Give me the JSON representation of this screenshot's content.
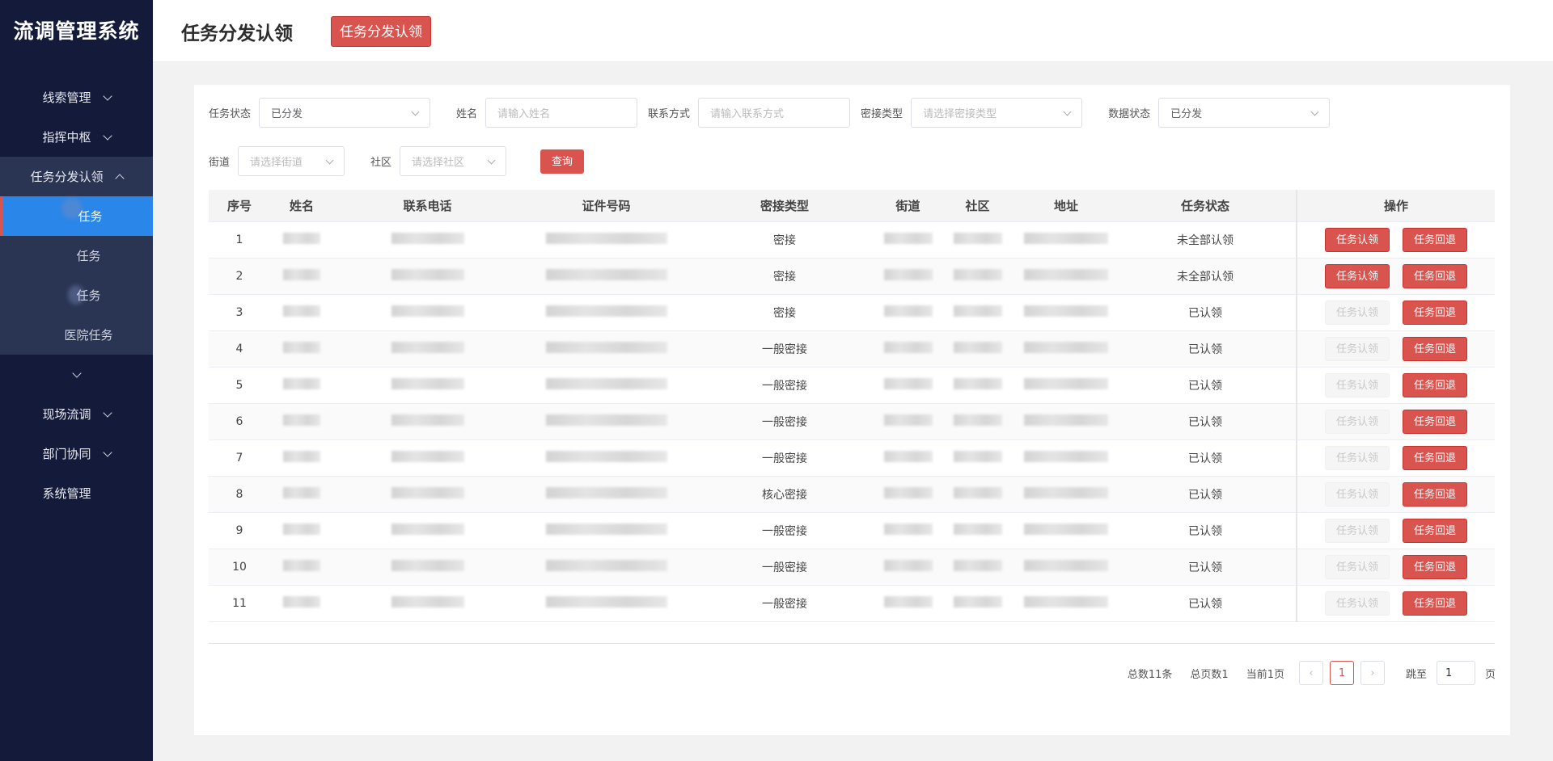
{
  "app": {
    "title": "流调管理系统"
  },
  "sidebar": {
    "items": [
      {
        "label": "线索管理",
        "expand": "down"
      },
      {
        "label": "指挥中枢",
        "expand": "down"
      },
      {
        "label": "任务分发认领",
        "expand": "up"
      },
      {
        "label": "",
        "expand": "down"
      },
      {
        "label": "现场流调",
        "expand": "down"
      },
      {
        "label": "部门协同",
        "expand": "down"
      },
      {
        "label": "系统管理",
        "expand": ""
      }
    ],
    "submenu": [
      {
        "label": "任务",
        "active": true
      },
      {
        "label": "任务",
        "active": false
      },
      {
        "label": "任务",
        "active": false
      },
      {
        "label": "医院任务",
        "active": false
      }
    ]
  },
  "header": {
    "title": "任务分发认领",
    "tag": "任务分发认领"
  },
  "filters": {
    "task_status": {
      "label": "任务状态",
      "value": "已分发"
    },
    "name": {
      "label": "姓名",
      "placeholder": "请输入姓名"
    },
    "contact": {
      "label": "联系方式",
      "placeholder": "请输入联系方式"
    },
    "contact_type": {
      "label": "密接类型",
      "placeholder": "请选择密接类型"
    },
    "data_status": {
      "label": "数据状态",
      "value": "已分发"
    },
    "street": {
      "label": "街道",
      "placeholder": "请选择街道"
    },
    "community": {
      "label": "社区",
      "placeholder": "请选择社区"
    },
    "query_label": "查询"
  },
  "table": {
    "columns": [
      "序号",
      "姓名",
      "联系电话",
      "证件号码",
      "密接类型",
      "街道",
      "社区",
      "地址",
      "任务状态",
      "操作"
    ],
    "claim_label": "任务认领",
    "return_label": "任务回退",
    "rows": [
      {
        "no": "1",
        "type": "密接",
        "status": "未全部认领",
        "claimable": true
      },
      {
        "no": "2",
        "type": "密接",
        "status": "未全部认领",
        "claimable": true
      },
      {
        "no": "3",
        "type": "密接",
        "status": "已认领",
        "claimable": false
      },
      {
        "no": "4",
        "type": "一般密接",
        "status": "已认领",
        "claimable": false
      },
      {
        "no": "5",
        "type": "一般密接",
        "status": "已认领",
        "claimable": false
      },
      {
        "no": "6",
        "type": "一般密接",
        "status": "已认领",
        "claimable": false
      },
      {
        "no": "7",
        "type": "一般密接",
        "status": "已认领",
        "claimable": false
      },
      {
        "no": "8",
        "type": "核心密接",
        "status": "已认领",
        "claimable": false
      },
      {
        "no": "9",
        "type": "一般密接",
        "status": "已认领",
        "claimable": false
      },
      {
        "no": "10",
        "type": "一般密接",
        "status": "已认领",
        "claimable": false
      },
      {
        "no": "11",
        "type": "一般密接",
        "status": "已认领",
        "claimable": false
      }
    ]
  },
  "pagination": {
    "total": "总数11条",
    "pages": "总页数1",
    "current": "当前1页",
    "page": "1",
    "jump_label": "跳至",
    "jump_value": "1",
    "page_unit": "页"
  },
  "colors": {
    "sidebar": "#141b3a",
    "accent": "#d9534f",
    "active": "#2a86e8"
  }
}
